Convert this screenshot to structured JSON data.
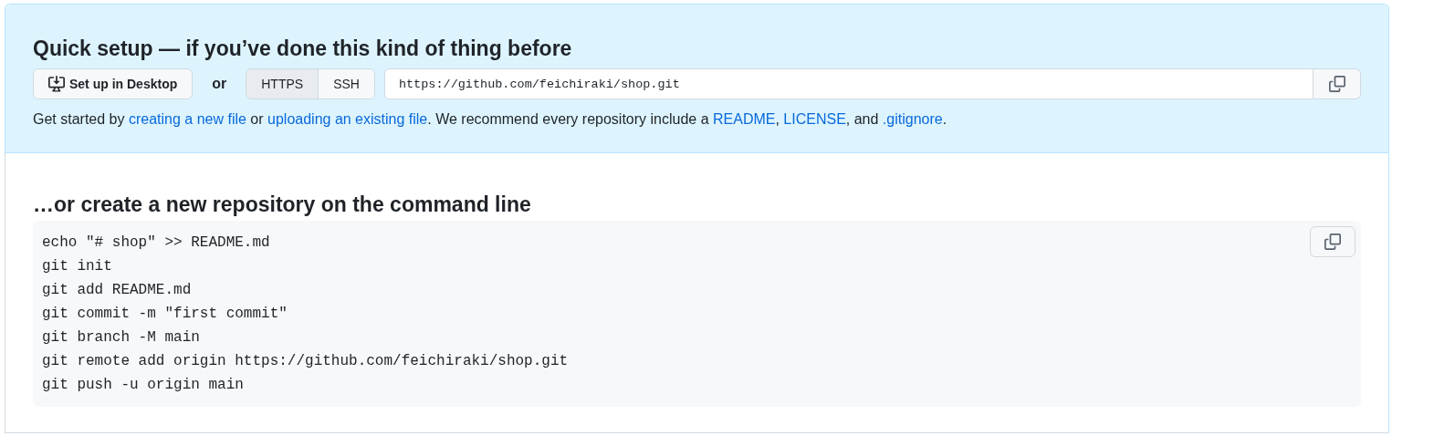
{
  "quick_setup": {
    "title": "Quick setup — if you’ve done this kind of thing before",
    "desktop_button": "Set up in Desktop",
    "or_label": "or",
    "protocols": [
      {
        "label": "HTTPS",
        "selected": true
      },
      {
        "label": "SSH",
        "selected": false
      }
    ],
    "clone_url": "https://github.com/feichiraki/shop.git",
    "help": [
      {
        "kind": "text",
        "text": "Get started by "
      },
      {
        "kind": "link",
        "text": "creating a new file"
      },
      {
        "kind": "text",
        "text": " or "
      },
      {
        "kind": "link",
        "text": "uploading an existing file"
      },
      {
        "kind": "text",
        "text": ". We recommend every repository include a "
      },
      {
        "kind": "link",
        "text": "README"
      },
      {
        "kind": "text",
        "text": ", "
      },
      {
        "kind": "link",
        "text": "LICENSE"
      },
      {
        "kind": "text",
        "text": ", and "
      },
      {
        "kind": "link",
        "text": ".gitignore"
      },
      {
        "kind": "text",
        "text": "."
      }
    ]
  },
  "command_line": {
    "title": "…or create a new repository on the command line",
    "code_lines": [
      "echo \"# shop\" >> README.md",
      "git init",
      "git add README.md",
      "git commit -m \"first commit\"",
      "git branch -M main",
      "git remote add origin https://github.com/feichiraki/shop.git",
      "git push -u origin main"
    ]
  }
}
